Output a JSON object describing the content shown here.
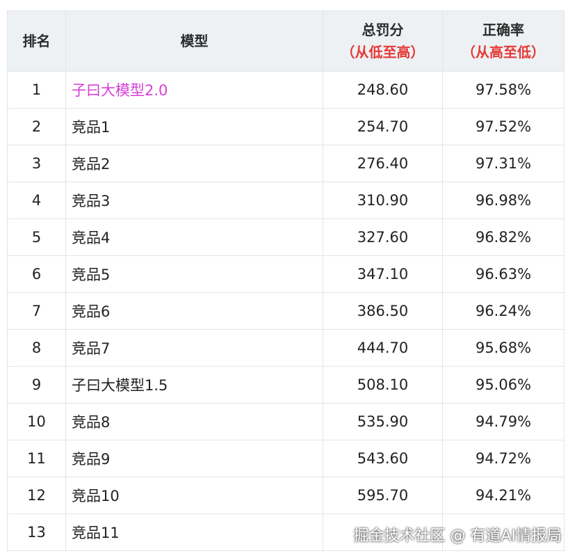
{
  "header": {
    "rank": "排名",
    "model": "模型",
    "penalty_title": "总罚分",
    "penalty_sub": "（从低至高）",
    "accuracy_title": "正确率",
    "accuracy_sub": "（从高至低）"
  },
  "rows": [
    {
      "rank": "1",
      "model": "子曰大模型2.0",
      "penalty": "248.60",
      "accuracy": "97.58%"
    },
    {
      "rank": "2",
      "model": "竞品1",
      "penalty": "254.70",
      "accuracy": "97.52%"
    },
    {
      "rank": "3",
      "model": "竞品2",
      "penalty": "276.40",
      "accuracy": "97.31%"
    },
    {
      "rank": "4",
      "model": "竞品3",
      "penalty": "310.90",
      "accuracy": "96.98%"
    },
    {
      "rank": "5",
      "model": "竞品4",
      "penalty": "327.60",
      "accuracy": "96.82%"
    },
    {
      "rank": "6",
      "model": "竞品5",
      "penalty": "347.10",
      "accuracy": "96.63%"
    },
    {
      "rank": "7",
      "model": "竞品6",
      "penalty": "386.50",
      "accuracy": "96.24%"
    },
    {
      "rank": "8",
      "model": "竞品7",
      "penalty": "444.70",
      "accuracy": "95.68%"
    },
    {
      "rank": "9",
      "model": "子曰大模型1.5",
      "penalty": "508.10",
      "accuracy": "95.06%"
    },
    {
      "rank": "10",
      "model": "竞品8",
      "penalty": "535.90",
      "accuracy": "94.79%"
    },
    {
      "rank": "11",
      "model": "竞品9",
      "penalty": "543.60",
      "accuracy": "94.72%"
    },
    {
      "rank": "12",
      "model": "竞品10",
      "penalty": "595.70",
      "accuracy": "94.21%"
    },
    {
      "rank": "13",
      "model": "竞品11",
      "penalty": "",
      "accuracy": ""
    }
  ],
  "watermark": "掘金技术社区 @ 有道AI情报局",
  "colors": {
    "highlight_text": "#d63fd6",
    "header_sub_text": "#e53935",
    "header_bg": "#eef1f4"
  }
}
